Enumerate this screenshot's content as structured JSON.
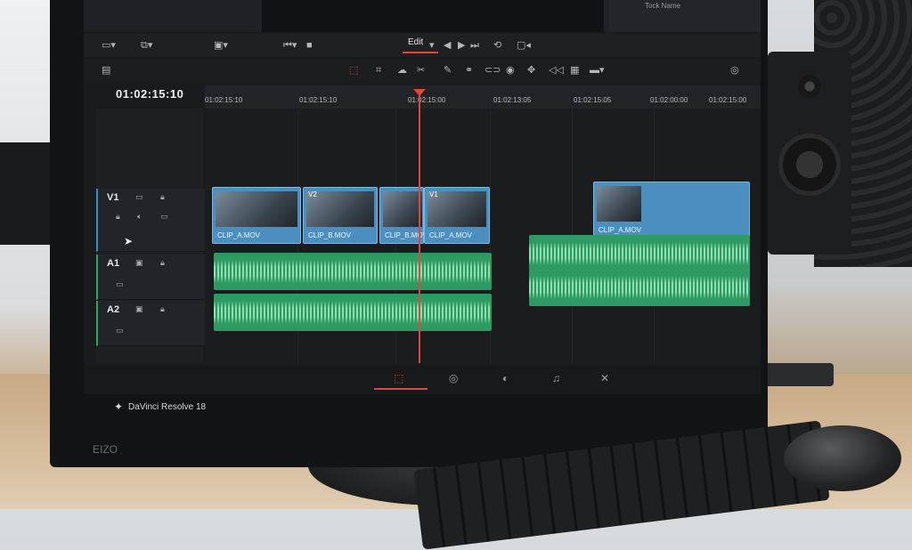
{
  "app": {
    "brand": "DaVinci Resolve 18",
    "monitor_brand": "EIZO"
  },
  "viewer": {
    "field_label": "Tock   Name"
  },
  "toolbar": {
    "mode_label": "Edit",
    "mode_chevron": "▾"
  },
  "timeline": {
    "timecode": "01:02:15:10",
    "ruler_ticks": [
      "01:02:15:10",
      "01:02:15:10",
      "01:02:15:00",
      "01:02:13:05",
      "01:02:15:05",
      "01:02:00:00",
      "01:02:15:00"
    ],
    "tracks": [
      {
        "id": "V1",
        "type": "video"
      },
      {
        "id": "A1",
        "type": "audio"
      },
      {
        "id": "A2",
        "type": "audio"
      }
    ],
    "video_clips": [
      {
        "name": "CLIP_A.MOV",
        "tag": ""
      },
      {
        "name": "CLIP_B.MOV",
        "tag": "V2"
      },
      {
        "name": "CLIP_B.MOV",
        "tag": ""
      },
      {
        "name": "CLIP_A.MOV",
        "tag": "V1"
      },
      {
        "name": "CLIP_A.MOV",
        "tag": ""
      }
    ]
  },
  "icons": {
    "pointer": "pointer-icon",
    "lock": "lock-icon",
    "speaker": "speaker-icon",
    "blade": "blade-icon",
    "snap": "snap-icon"
  },
  "colors": {
    "accent": "#e0473c",
    "video_clip": "#4a8fbf",
    "audio_clip": "#2e9a63",
    "waveform": "#8fe0b0"
  }
}
